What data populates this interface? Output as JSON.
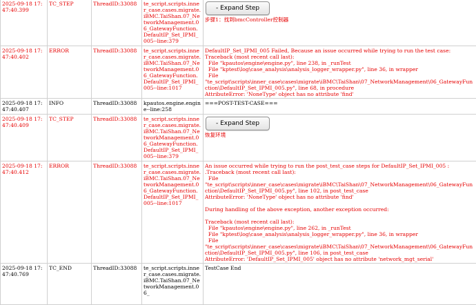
{
  "rows": [
    {
      "timestamp": "2025-09-18 17:47:40.399",
      "level": "TC_STEP",
      "thread": "ThreadID:33088",
      "source": "te_script.scripts.inner_case.cases.migrate.iBMC.TaiShan.07_NetworkManagement.06_GatewayFunction.DefaultIP_Set_IPMI_005--line:379",
      "button": "- Expand Step",
      "message": "步骤1：找到bmcController控制器"
    },
    {
      "timestamp": "2025-09-18 17:47:40.402",
      "level": "ERROR",
      "thread": "ThreadID:33088",
      "source": "te_script.scripts.inner_case.cases.migrate.iBMC.TaiShan.07_NetworkManagement.06_GatewayFunction.DefaultIP_Set_IPMI_005--line:1017",
      "message": "DefaultIP_Set_IPMI_005 Failed, Because an issue occurred while trying to run the test case:\nTraceback (most recent call last):\n  File \"kpautos\\engine\\engine.py\", line 238, in _runTest\n  File \"kptest\\log\\case_analysis\\analysis_logger_wrapper.py\", line 36, in wrapper\n  File\n\"te_script\\scripts\\inner_case\\cases\\migrate\\iBMC\\TaiShan\\07_NetworkManagement\\06_GatewayFunction\\DefaultIP_Set_IPMI_005.py\", line 68, in procedure\nAttributeError: 'NoneType' object has no attribute 'find'"
    },
    {
      "timestamp": "2025-09-18 17:47:40.407",
      "level": "INFO",
      "thread": "ThreadID:33088",
      "source": "kpautos.engine.engine--line:258",
      "message": "===POST-TEST-CASE==="
    },
    {
      "timestamp": "2025-09-18 17:47:40.409",
      "level": "TC_STEP",
      "thread": "ThreadID:33088",
      "source": "te_script.scripts.inner_case.cases.migrate.iBMC.TaiShan.07_NetworkManagement.06_GatewayFunction.DefaultIP_Set_IPMI_005--line:379",
      "button": "- Expand Step",
      "message": "恢复环境"
    },
    {
      "timestamp": "2025-09-18 17:47:40.412",
      "level": "ERROR",
      "thread": "ThreadID:33088",
      "source": "te_script.scripts.inner_case.cases.migrate.iBMC.TaiShan.07_NetworkManagement.06_GatewayFunction.DefaultIP_Set_IPMI_005--line:1017",
      "message": "An issue occurred while trying to run the post_test_case steps for DefaultIP_Set_IPMI_005 :\n.Traceback (most recent call last):\n  File\n\"te_script\\scripts\\inner_case\\cases\\migrate\\iBMC\\TaiShan\\07_NetworkManagement\\06_GatewayFunction\\DefaultIP_Set_IPMI_005.py\", line 102, in post_test_case\nAttributeError: 'NoneType' object has no attribute 'find'\n\nDuring handling of the above exception, another exception occurred:\n\nTraceback (most recent call last):\n  File \"kpautos\\engine\\engine.py\", line 262, in _runTest\n  File \"kptest\\log\\case_analysis\\analysis_logger_wrapper.py\", line 36, in wrapper\n  File\n\"te_script\\scripts\\inner_case\\cases\\migrate\\iBMC\\TaiShan\\07_NetworkManagement\\06_GatewayFunction\\DefaultIP_Set_IPMI_005.py\", line 106, in post_test_case\nAttributeError: 'DefaultIP_Set_IPMI_005' object has no attribute 'network_mgt_serial'"
    },
    {
      "timestamp": "2025-09-18 17:47:40.769",
      "level": "TC_END",
      "thread": "ThreadID:33088",
      "source": "te_script.scripts.inner_case.cases.migrate.iBMC.TaiShan.07_NetworkManagement.06_",
      "message": "TestCase End"
    }
  ],
  "colors": {
    "error_text": "#e60000",
    "normal_text": "#000000",
    "grid": "#cfcfcf"
  }
}
